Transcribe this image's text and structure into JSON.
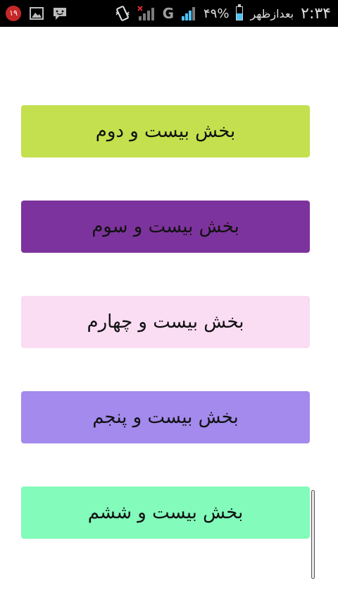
{
  "status_bar": {
    "notification_count": "۱۹",
    "network_type": "G",
    "battery_percent": "۴۹%",
    "battery_level": 0.49,
    "time_period": "بعدازظهر",
    "time": "۲:۳۴"
  },
  "sections": [
    {
      "label": "بخش بیست و دوم",
      "color": "#c4e04e"
    },
    {
      "label": "بخش بیست و سوم",
      "color": "#7d339d"
    },
    {
      "label": "بخش بیست و چهارم",
      "color": "#fadcf3"
    },
    {
      "label": "بخش بیست و پنجم",
      "color": "#a38aec"
    },
    {
      "label": "بخش بیست و ششم",
      "color": "#82fbbb"
    }
  ],
  "scroll_position": 0.85
}
